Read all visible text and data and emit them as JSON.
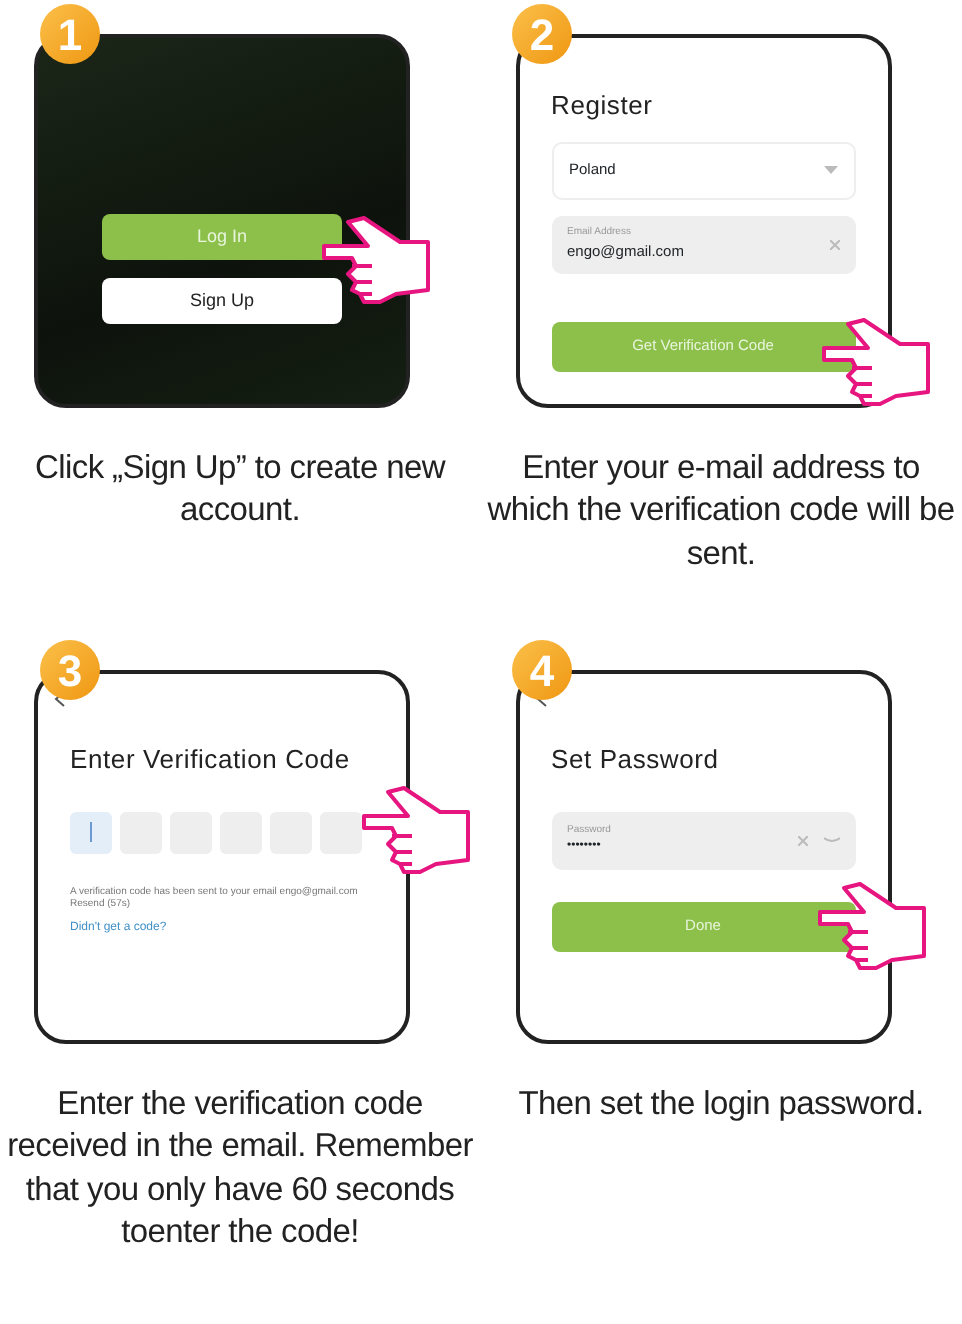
{
  "steps": [
    {
      "number": "1",
      "kind": "welcome",
      "buttons": [
        {
          "label": "Log In",
          "primary": true
        },
        {
          "label": "Sign Up",
          "primary": false
        }
      ],
      "caption": "Click „Sign Up” to create new account."
    },
    {
      "number": "2",
      "kind": "register",
      "title": "Register",
      "country": "Poland",
      "email_label": "Email Address",
      "email_value": "engo@gmail.com",
      "button": "Get Verification Code",
      "caption": "Enter your e-mail address to which the verification code will be sent."
    },
    {
      "number": "3",
      "kind": "verify",
      "title": "Enter Verification Code",
      "code_cells": [
        {
          "selected": true
        },
        {
          "selected": false
        },
        {
          "selected": false
        },
        {
          "selected": false
        },
        {
          "selected": false
        },
        {
          "selected": false
        }
      ],
      "message": "A verification code has been sent to your email engo@gmail.com Resend (57s)",
      "link": "Didn't get a code?",
      "caption": "Enter the verification code received in the email. Remember that you only have 60 seconds toenter the code!"
    },
    {
      "number": "4",
      "kind": "password",
      "title": "Set Password",
      "password_label": "Password",
      "password_value": "••••••••",
      "button": "Done",
      "caption": "Then set the login password."
    }
  ]
}
